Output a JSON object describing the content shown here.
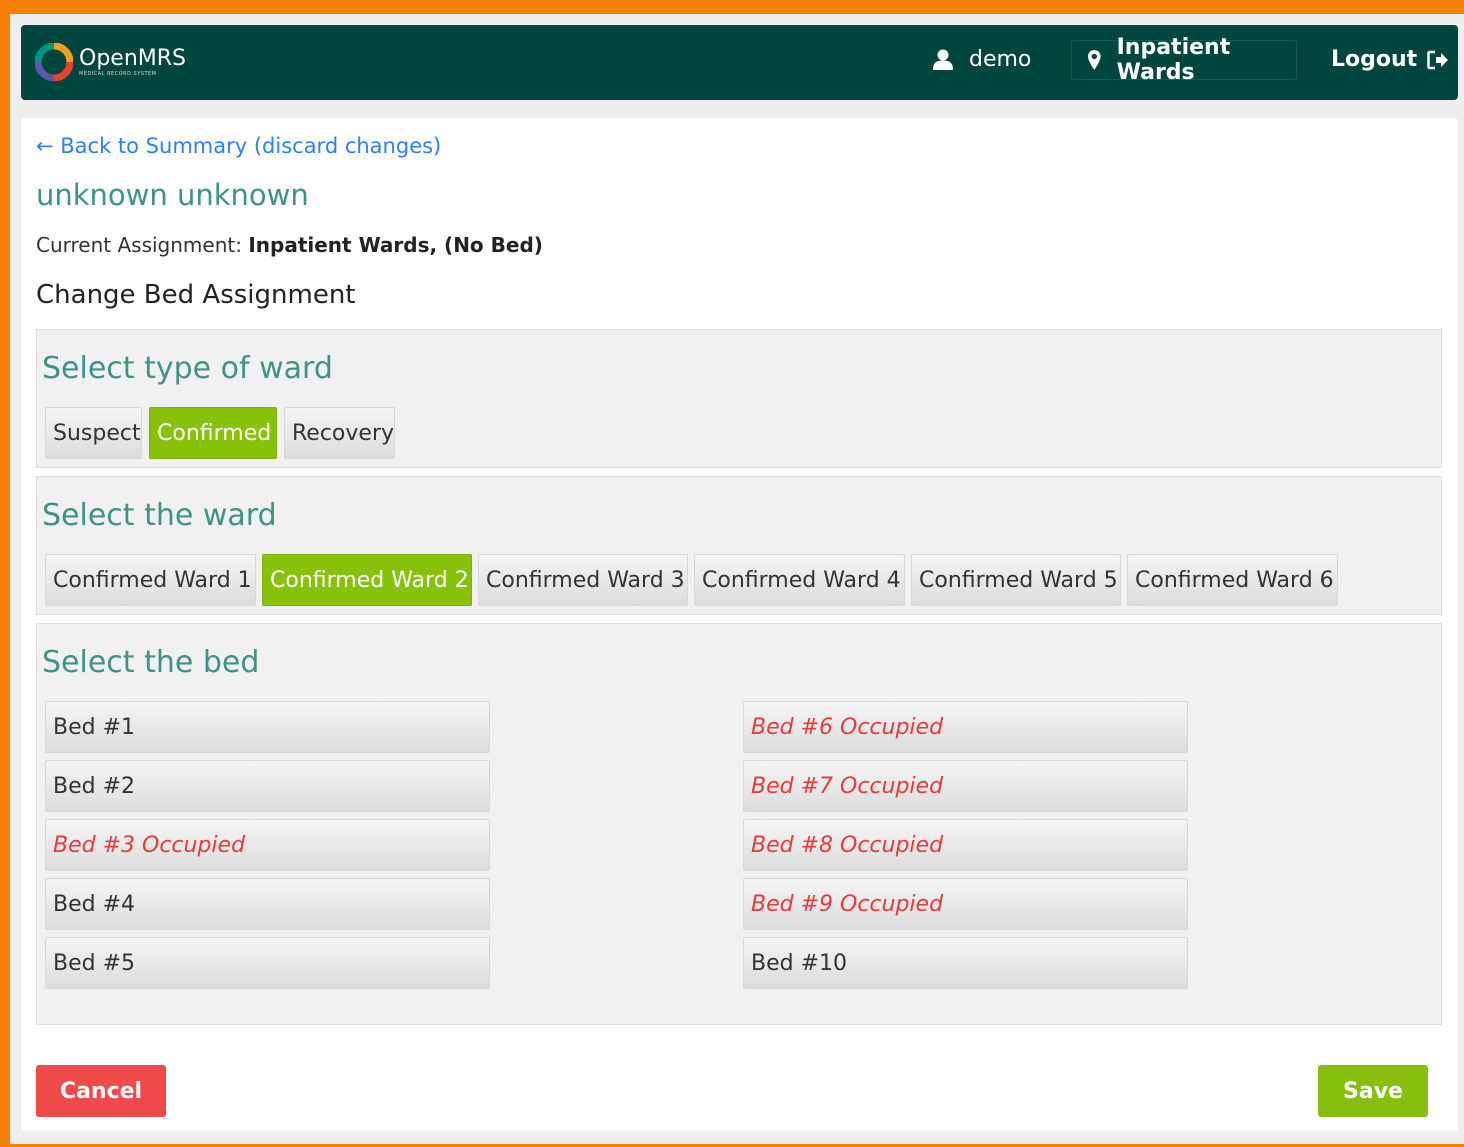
{
  "header": {
    "logo_text": "OpenMRS",
    "logo_subtext": "MEDICAL RECORD SYSTEM",
    "user": "demo",
    "location": "Inpatient Wards",
    "logout": "Logout"
  },
  "page": {
    "back_link": "← Back to Summary (discard changes)",
    "patient_name": "unknown unknown",
    "current_assignment_label": "Current Assignment:",
    "current_assignment_value": "Inpatient Wards, (No Bed)",
    "change_title": "Change Bed Assignment"
  },
  "ward_type": {
    "title": "Select type of ward",
    "options": [
      "Suspect",
      "Confirmed",
      "Recovery"
    ],
    "selected": "Confirmed"
  },
  "ward": {
    "title": "Select the ward",
    "options": [
      "Confirmed Ward 1",
      "Confirmed Ward 2",
      "Confirmed Ward 3",
      "Confirmed Ward 4",
      "Confirmed Ward 5",
      "Confirmed Ward 6"
    ],
    "selected": "Confirmed Ward 2"
  },
  "bed": {
    "title": "Select the bed",
    "beds": [
      {
        "label": "Bed #1",
        "occupied": false
      },
      {
        "label": "Bed #2",
        "occupied": false
      },
      {
        "label": "Bed #3 Occupied",
        "occupied": true
      },
      {
        "label": "Bed #4",
        "occupied": false
      },
      {
        "label": "Bed #5",
        "occupied": false
      },
      {
        "label": "Bed #6 Occupied",
        "occupied": true
      },
      {
        "label": "Bed #7 Occupied",
        "occupied": true
      },
      {
        "label": "Bed #8 Occupied",
        "occupied": true
      },
      {
        "label": "Bed #9 Occupied",
        "occupied": true
      },
      {
        "label": "Bed #10",
        "occupied": false
      }
    ]
  },
  "actions": {
    "cancel": "Cancel",
    "save": "Save"
  },
  "colors": {
    "header_bg": "#00463f",
    "accent_green": "#88c10a",
    "cancel_red": "#ef4b4b",
    "occupied_red": "#e43b3b",
    "title_teal": "#3e9385",
    "link_blue": "#2f80ed",
    "frame_orange": "#f7800a"
  }
}
